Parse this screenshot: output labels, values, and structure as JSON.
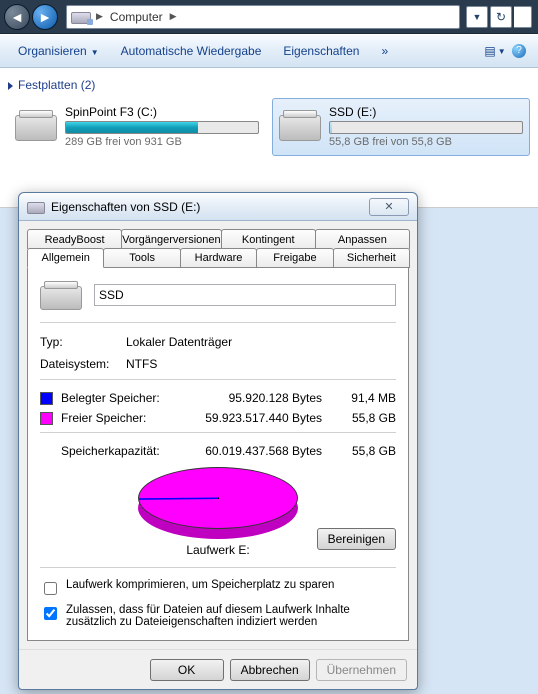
{
  "topbar": {
    "breadcrumb_label": "Computer",
    "refresh_glyph": "↻"
  },
  "cmdbar": {
    "organize": "Organisieren",
    "autoplay": "Automatische Wiedergabe",
    "properties": "Eigenschaften",
    "chevrons": "»"
  },
  "content": {
    "group_header": "Festplatten (2)",
    "drives": [
      {
        "name": "SpinPoint F3 (C:)",
        "free_text": "289 GB frei von 931 GB",
        "fill_pct": 69,
        "selected": false
      },
      {
        "name": "SSD (E:)",
        "free_text": "55,8 GB frei von 55,8 GB",
        "fill_pct": 1,
        "selected": true
      }
    ]
  },
  "dialog": {
    "title": "Eigenschaften von SSD (E:)",
    "close_glyph": "✕",
    "tabs_back": [
      "ReadyBoost",
      "Vorgängerversionen",
      "Kontingent",
      "Anpassen"
    ],
    "tabs_front": [
      "Allgemein",
      "Tools",
      "Hardware",
      "Freigabe",
      "Sicherheit"
    ],
    "active_tab": "Allgemein",
    "general": {
      "name_value": "SSD",
      "type_label": "Typ:",
      "type_value": "Lokaler Datenträger",
      "fs_label": "Dateisystem:",
      "fs_value": "NTFS",
      "used_label": "Belegter Speicher:",
      "used_bytes": "95.920.128 Bytes",
      "used_hr": "91,4 MB",
      "free_label": "Freier Speicher:",
      "free_bytes": "59.923.517.440 Bytes",
      "free_hr": "55,8 GB",
      "cap_label": "Speicherkapazität:",
      "cap_bytes": "60.019.437.568 Bytes",
      "cap_hr": "55,8 GB",
      "drive_caption": "Laufwerk E:",
      "cleanup_btn": "Bereinigen",
      "compress_label": "Laufwerk komprimieren, um Speicherplatz zu sparen",
      "compress_checked": false,
      "index_label": "Zulassen, dass für Dateien auf diesem Laufwerk Inhalte zusätzlich zu Dateieigenschaften indiziert werden",
      "index_checked": true
    },
    "footer": {
      "ok": "OK",
      "cancel": "Abbrechen",
      "apply": "Übernehmen"
    }
  },
  "chart_data": {
    "type": "pie",
    "title": "Laufwerk E:",
    "series": [
      {
        "name": "Belegter Speicher",
        "value": 95920128,
        "color": "#0000ff",
        "hr": "91,4 MB"
      },
      {
        "name": "Freier Speicher",
        "value": 59923517440,
        "color": "#ff00ff",
        "hr": "55,8 GB"
      }
    ],
    "total": {
      "name": "Speicherkapazität",
      "value": 60019437568,
      "hr": "55,8 GB"
    }
  }
}
